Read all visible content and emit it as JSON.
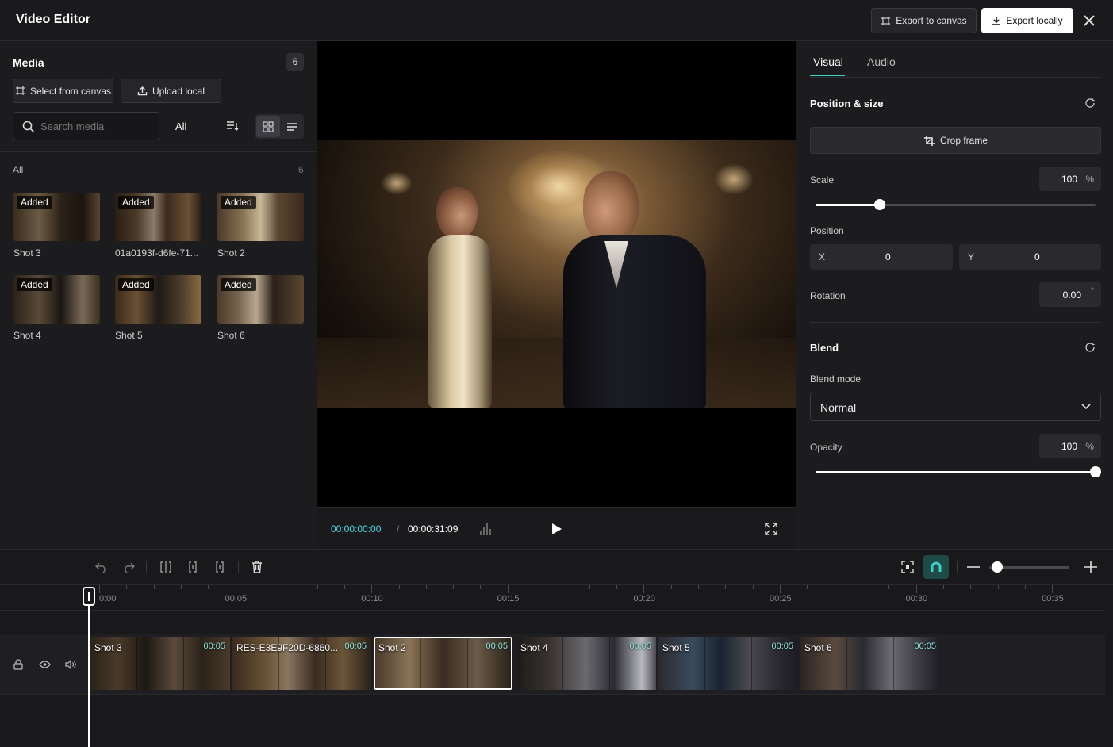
{
  "header": {
    "title": "Video Editor",
    "export_canvas_label": "Export to canvas",
    "export_local_label": "Export locally"
  },
  "media": {
    "title": "Media",
    "count": "6",
    "select_canvas_label": "Select from canvas",
    "upload_label": "Upload local",
    "search_placeholder": "Search media",
    "filter_label": "All",
    "group_label": "All",
    "group_count": "6",
    "items": [
      {
        "label": "Shot 3",
        "badge": "Added"
      },
      {
        "label": "01a0193f-d6fe-71...",
        "badge": "Added"
      },
      {
        "label": "Shot 2",
        "badge": "Added"
      },
      {
        "label": "Shot 4",
        "badge": "Added"
      },
      {
        "label": "Shot 5",
        "badge": "Added"
      },
      {
        "label": "Shot 6",
        "badge": "Added"
      }
    ]
  },
  "player": {
    "current_time": "00:00:00:00",
    "separator": "/",
    "total_time": "00:00:31:09"
  },
  "inspector": {
    "tabs": [
      "Visual",
      "Audio"
    ],
    "position_size_title": "Position & size",
    "crop_label": "Crop frame",
    "scale_label": "Scale",
    "scale_value": "100",
    "scale_unit": "%",
    "scale_fraction": 0.23,
    "position_label": "Position",
    "x_label": "X",
    "x_value": "0",
    "y_label": "Y",
    "y_value": "0",
    "rotation_label": "Rotation",
    "rotation_value": "0.00",
    "rotation_unit": "°",
    "blend_title": "Blend",
    "blend_mode_label": "Blend mode",
    "blend_mode_value": "Normal",
    "opacity_label": "Opacity",
    "opacity_value": "100",
    "opacity_unit": "%",
    "opacity_fraction": 1.0
  },
  "timeline": {
    "ruler": [
      "0:00",
      "00:05",
      "00:10",
      "00:15",
      "00:20",
      "00:25",
      "00:30",
      "00:35"
    ],
    "zoom_fraction": 0.1,
    "clips": [
      {
        "name": "Shot 3",
        "duration": "00:05"
      },
      {
        "name": "RES-E3E9F20D-6860...",
        "duration": "00:05"
      },
      {
        "name": "Shot 2",
        "duration": "00:05"
      },
      {
        "name": "Shot 4",
        "duration": "00:05"
      },
      {
        "name": "Shot 5",
        "duration": "00:05"
      },
      {
        "name": "Shot 6",
        "duration": "00:05"
      }
    ]
  },
  "colors": {
    "accent": "#3fd1c6",
    "panel": "#1c1c1f",
    "timecode": "#4fd8e0"
  }
}
